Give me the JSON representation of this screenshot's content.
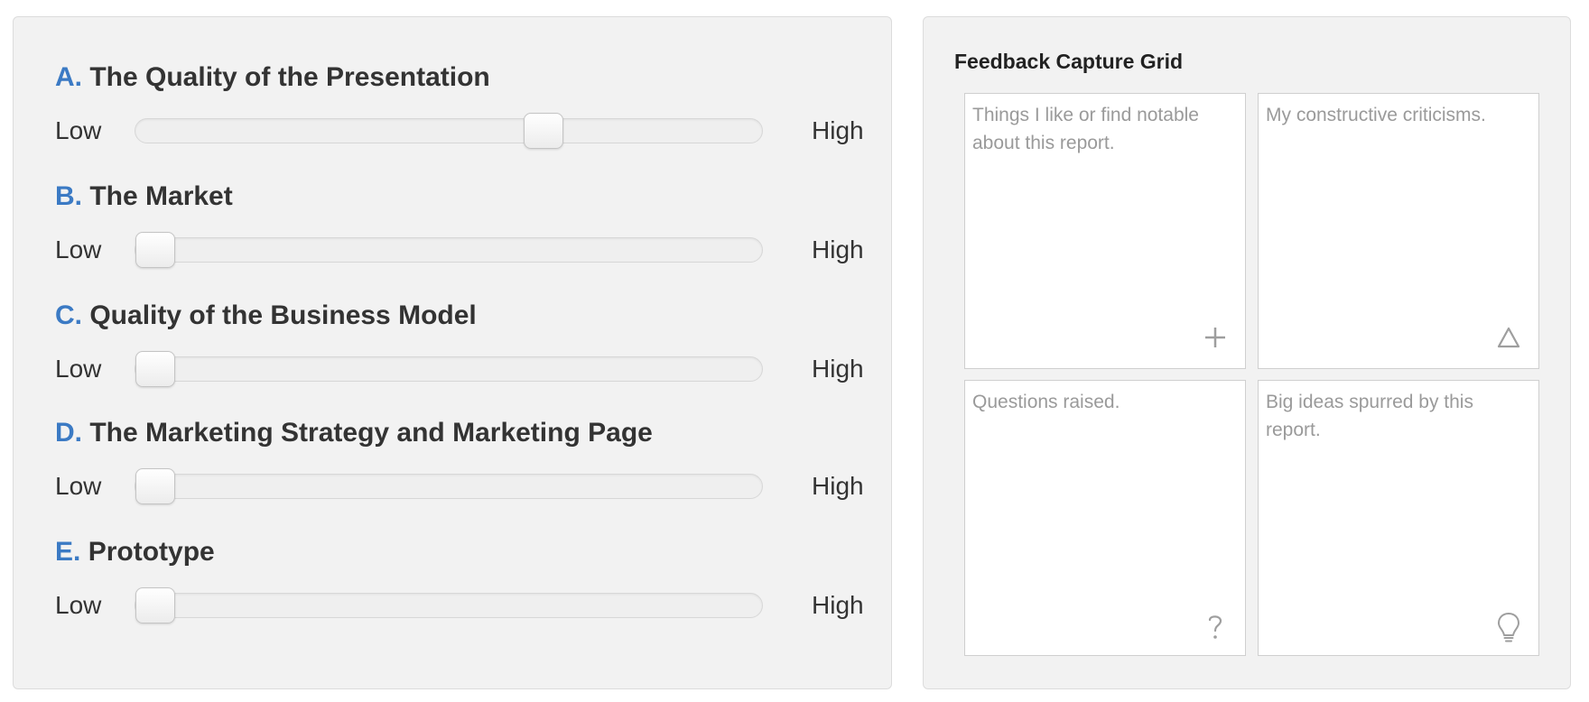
{
  "ratings": [
    {
      "letter": "A.",
      "title": "The Quality of the Presentation",
      "low_label": "Low",
      "high_label": "High",
      "value": 0.66
    },
    {
      "letter": "B.",
      "title": "The Market",
      "low_label": "Low",
      "high_label": "High",
      "value": 0.0
    },
    {
      "letter": "C.",
      "title": "Quality of the Business Model",
      "low_label": "Low",
      "high_label": "High",
      "value": 0.0
    },
    {
      "letter": "D.",
      "title": "The Marketing Strategy and Marketing Page",
      "low_label": "Low",
      "high_label": "High",
      "value": 0.0
    },
    {
      "letter": "E.",
      "title": "Prototype",
      "low_label": "Low",
      "high_label": "High",
      "value": 0.0
    }
  ],
  "feedback_grid": {
    "title": "Feedback Capture Grid",
    "quadrants": [
      {
        "placeholder": "Things I like or find notable about this report.",
        "icon": "plus-icon"
      },
      {
        "placeholder": "My constructive criticisms.",
        "icon": "delta-icon"
      },
      {
        "placeholder": "Questions raised.",
        "icon": "question-icon"
      },
      {
        "placeholder": "Big ideas spurred by this report.",
        "icon": "lightbulb-icon"
      }
    ]
  },
  "colors": {
    "letter_accent": "#3b7ac4",
    "panel_background": "#f2f2f2",
    "placeholder_text": "#9a9a9a"
  }
}
